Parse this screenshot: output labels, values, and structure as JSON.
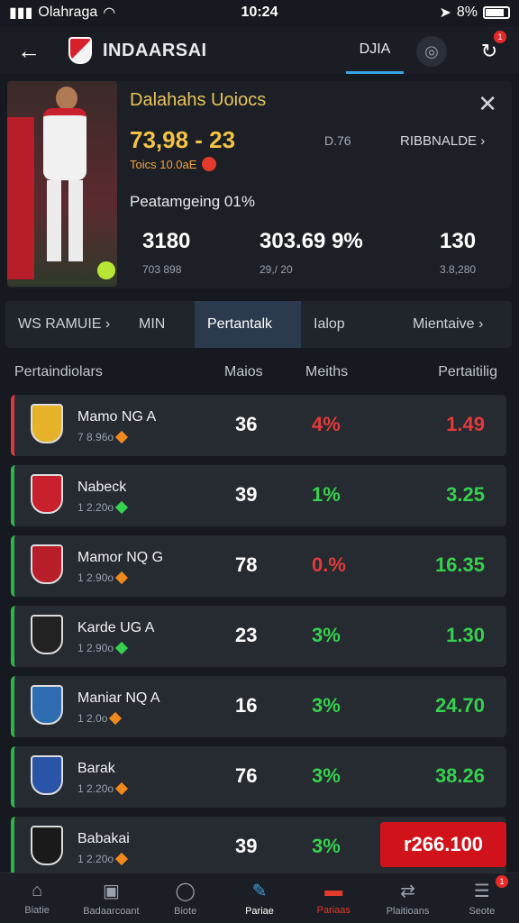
{
  "status": {
    "carrier": "Olahraga",
    "time": "10:24",
    "battery": "8%"
  },
  "header": {
    "title": "INDAARSAI",
    "tab": "DJIA",
    "notif_count": "1"
  },
  "hero": {
    "title": "Dalahahs Uoiocs",
    "score": "73,98 - 23",
    "mid": "D.76",
    "link": "RIBBNALDE",
    "small": "Toics 10.0aE",
    "section": "Peatamgeing 01%",
    "stats": [
      {
        "value": "3180",
        "sub": "703 898"
      },
      {
        "value": "303.69 9%",
        "sub": "29,/ 20"
      },
      {
        "value": "130",
        "sub": "3.8,280"
      }
    ]
  },
  "tabs": [
    "WS RAMUIE",
    "MIN",
    "Pertantalk",
    "Ialop",
    "Mientaive"
  ],
  "columns": {
    "team": "Pertaindiolars",
    "matches": "Maios",
    "pct": "Meiths",
    "odds": "Pertaitilig"
  },
  "rows": [
    {
      "name": "Mamo NG A",
      "sub": "7 8.96o",
      "matches": "36",
      "pct": "4%",
      "odds": "1.49",
      "pct_color": "#e23b3b",
      "odds_color": "#e23b3b",
      "result": "loss",
      "crest": "#e6b22a",
      "diamond": "#f08a1e"
    },
    {
      "name": "Nabeck",
      "sub": "1 2.20o",
      "matches": "39",
      "pct": "1%",
      "odds": "3.25",
      "pct_color": "#36d14f",
      "odds_color": "#36d14f",
      "result": "win",
      "crest": "#c8202c",
      "diamond": "#36d14f"
    },
    {
      "name": "Mamor NQ G",
      "sub": "1 2.90o",
      "matches": "78",
      "pct": "0.%",
      "odds": "16.35",
      "pct_color": "#e23b3b",
      "odds_color": "#36d14f",
      "result": "win",
      "crest": "#b81e2a",
      "diamond": "#f08a1e"
    },
    {
      "name": "Karde UG A",
      "sub": "1 2.90o",
      "matches": "23",
      "pct": "3%",
      "odds": "1.30",
      "pct_color": "#36d14f",
      "odds_color": "#36d14f",
      "result": "win",
      "crest": "#222222",
      "diamond": "#36d14f"
    },
    {
      "name": "Maniar NQ A",
      "sub": "1 2.0o",
      "matches": "16",
      "pct": "3%",
      "odds": "24.70",
      "pct_color": "#36d14f",
      "odds_color": "#36d14f",
      "result": "win",
      "crest": "#2f6db3",
      "diamond": "#f08a1e"
    },
    {
      "name": "Barak",
      "sub": "1 2.20o",
      "matches": "76",
      "pct": "3%",
      "odds": "38.26",
      "pct_color": "#36d14f",
      "odds_color": "#36d14f",
      "result": "win",
      "crest": "#2a54a8",
      "diamond": "#f08a1e"
    },
    {
      "name": "Babakai",
      "sub": "1 2.20o",
      "matches": "39",
      "pct": "3%",
      "odds": "r266.100",
      "pct_color": "#36d14f",
      "odds_color": "#ffffff",
      "result": "win",
      "crest": "#1a1a1a",
      "diamond": "#f08a1e",
      "highlight": true
    }
  ],
  "nav": [
    {
      "label": "Biatie",
      "icon": "home-icon",
      "glyph": "⌂"
    },
    {
      "label": "Badaarcoant",
      "icon": "scoreboard-icon",
      "glyph": "▣"
    },
    {
      "label": "Biote",
      "icon": "ball-icon",
      "glyph": "◯"
    },
    {
      "label": "Pariae",
      "icon": "bet-slip-icon",
      "glyph": "✎"
    },
    {
      "label": "Pariaas",
      "icon": "stats-icon",
      "glyph": "▬"
    },
    {
      "label": "Plaitioans",
      "icon": "transfers-icon",
      "glyph": "⇄"
    },
    {
      "label": "Seote",
      "icon": "menu-icon",
      "glyph": "☰",
      "badge": "1"
    }
  ]
}
